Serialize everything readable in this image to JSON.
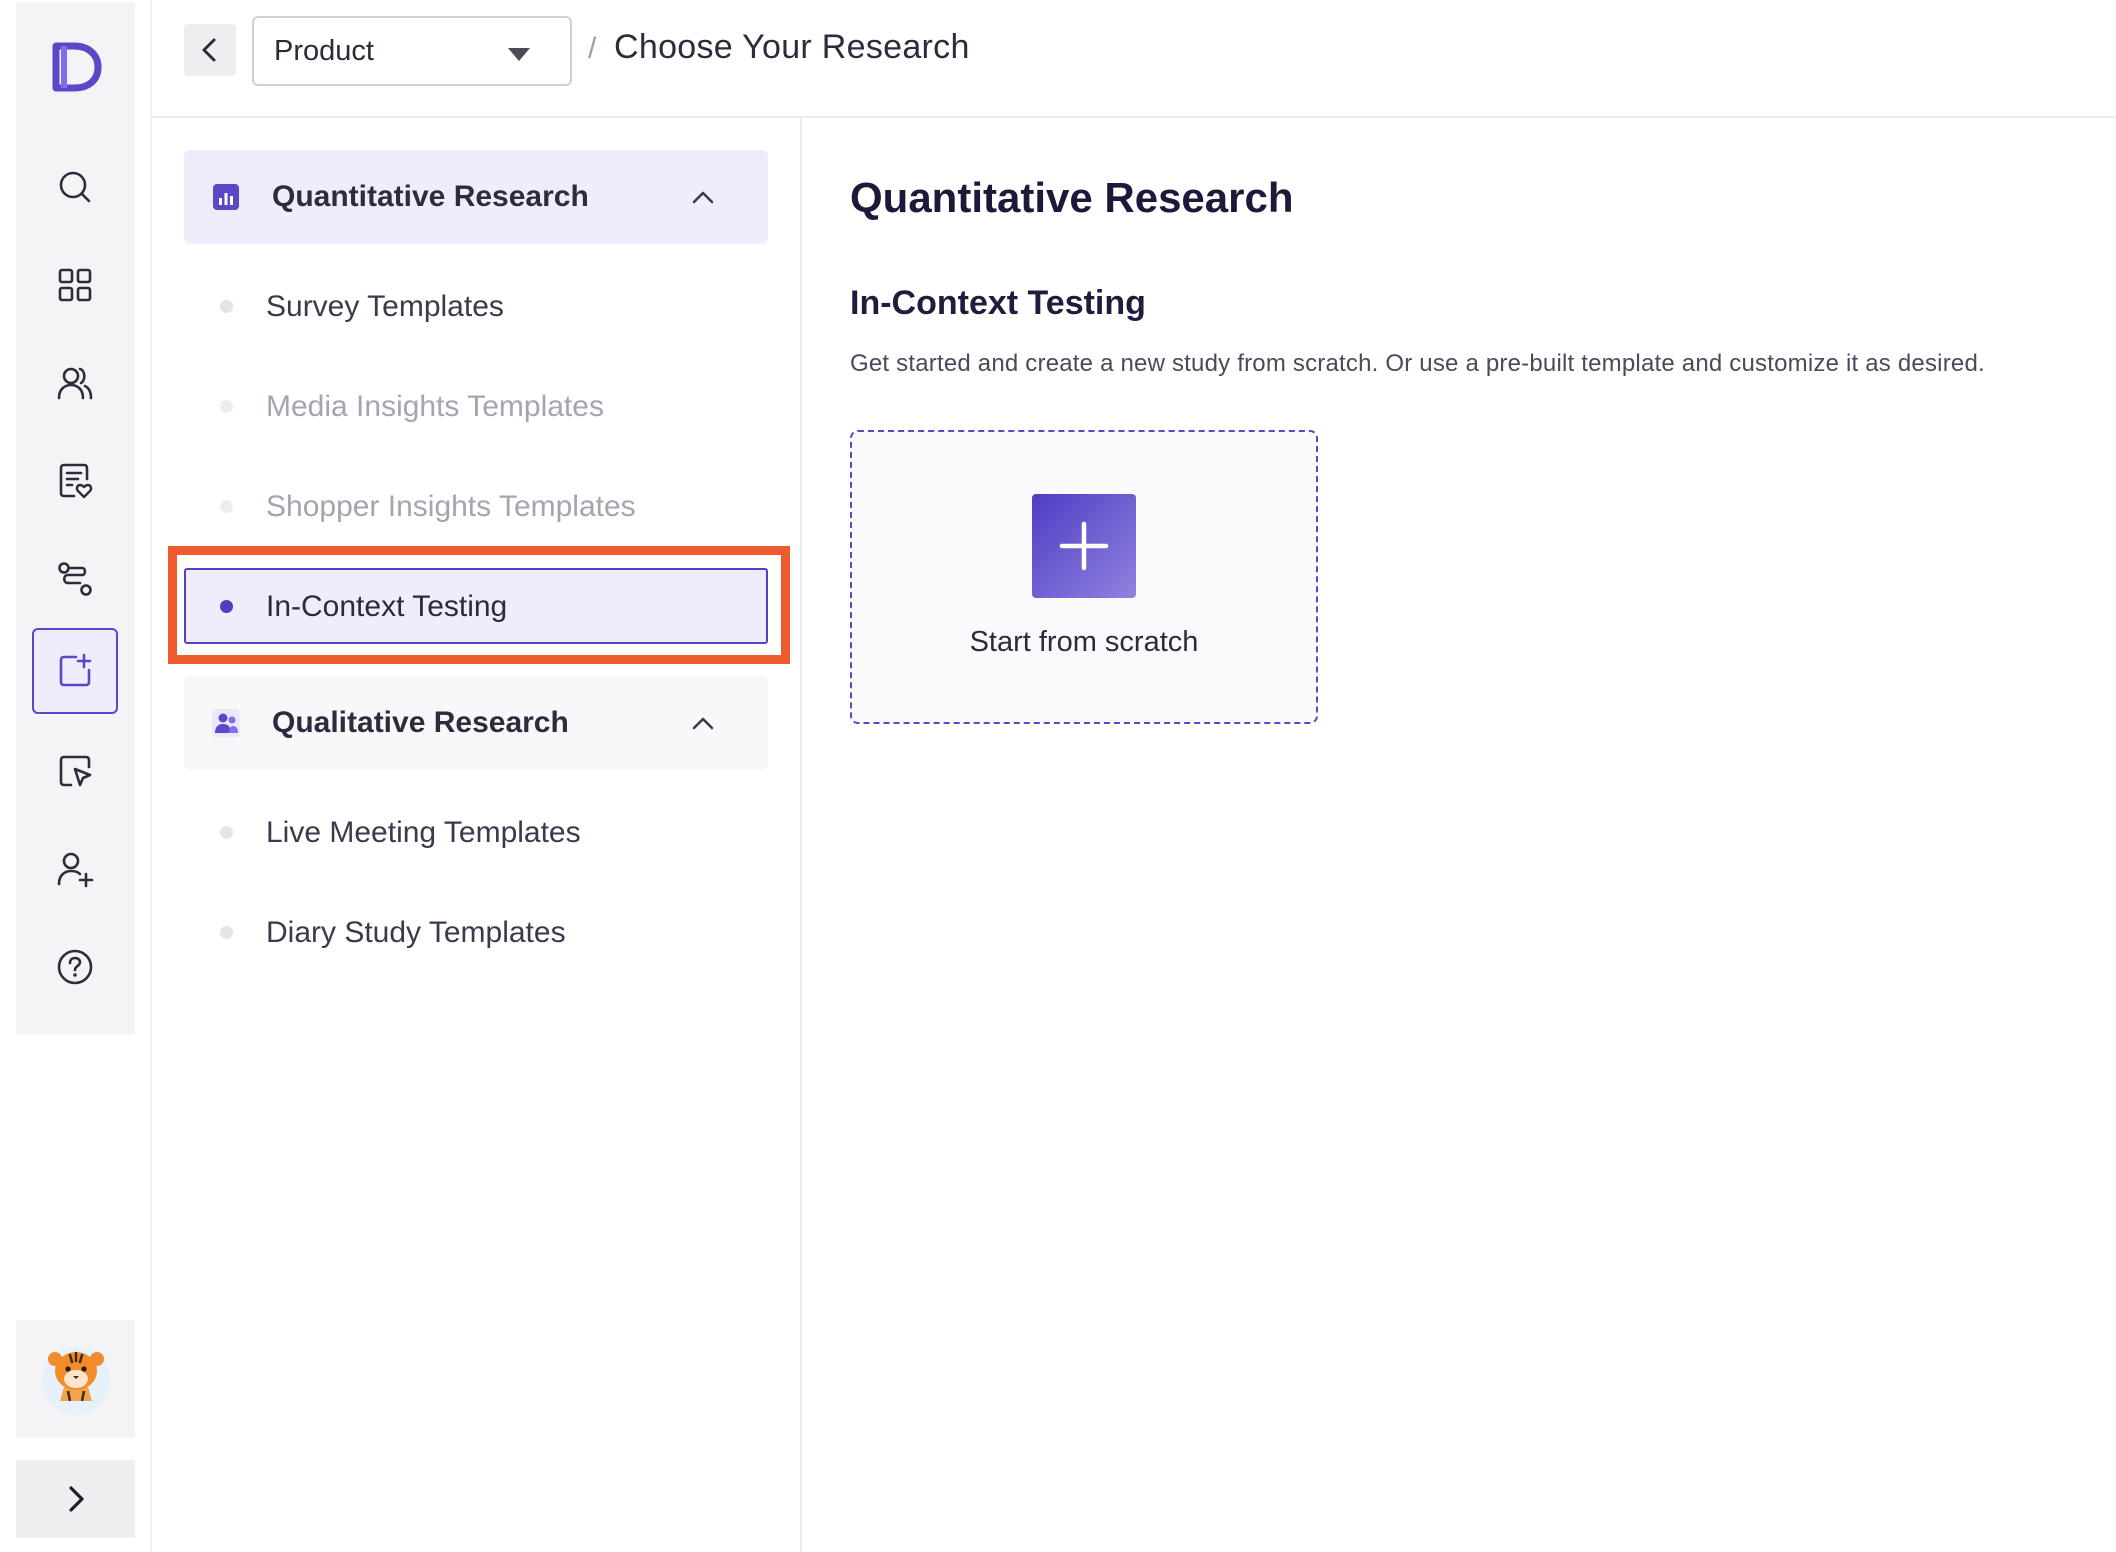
{
  "header": {
    "product_select": "Product",
    "crumb_separator": "/",
    "title": "Choose Your Research"
  },
  "rail": {
    "items": [
      "search-icon",
      "grid-icon",
      "users-icon",
      "survey-doc-icon",
      "route-icon",
      "new-study-icon",
      "click-test-icon",
      "add-user-icon",
      "help-icon"
    ],
    "active": "new-study-icon"
  },
  "sidebar": {
    "sections": [
      {
        "label": "Quantitative Research",
        "icon": "bar-chart-icon",
        "expanded": true,
        "items": [
          {
            "label": "Survey Templates",
            "state": "normal"
          },
          {
            "label": "Media Insights Templates",
            "state": "muted"
          },
          {
            "label": "Shopper Insights Templates",
            "state": "muted"
          },
          {
            "label": "In-Context Testing",
            "state": "selected"
          }
        ]
      },
      {
        "label": "Qualitative Research",
        "icon": "people-icon",
        "expanded": true,
        "items": [
          {
            "label": "Live Meeting Templates",
            "state": "normal"
          },
          {
            "label": "Diary Study Templates",
            "state": "normal"
          }
        ]
      }
    ]
  },
  "main": {
    "title": "Quantitative Research",
    "subtitle": "In-Context Testing",
    "description": "Get started and create a new study from scratch. Or use a pre-built template and customize it as desired.",
    "card_label": "Start from scratch"
  },
  "colors": {
    "accent": "#5b47c8",
    "highlight": "#ef5a2f",
    "selected_bg": "#efedfb"
  }
}
